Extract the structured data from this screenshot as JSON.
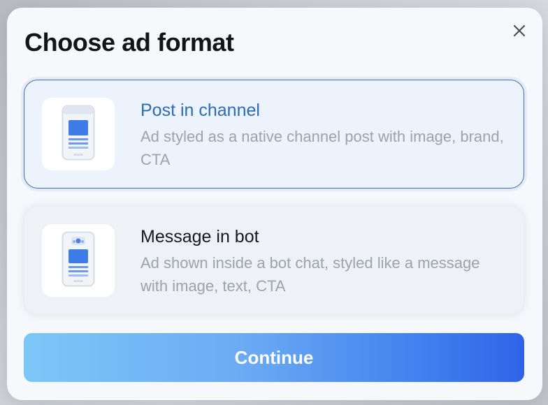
{
  "dialog": {
    "title": "Choose ad format",
    "close_icon": "close-icon"
  },
  "options": [
    {
      "title": "Post in channel",
      "description": "Ad styled as a native channel post with image, brand, CTA",
      "selected": true,
      "icon": "phone-post-icon"
    },
    {
      "title": "Message in bot",
      "description": "Ad shown inside a bot chat, styled like a message with image, text, CTA",
      "selected": false,
      "icon": "phone-bot-message-icon"
    }
  ],
  "continue_label": "Continue",
  "colors": {
    "selected_title": "#2e6cb5",
    "selected_border": "#3f6fb0",
    "button_gradient_start": "#7cc7f7",
    "button_gradient_end": "#2f63e8"
  }
}
